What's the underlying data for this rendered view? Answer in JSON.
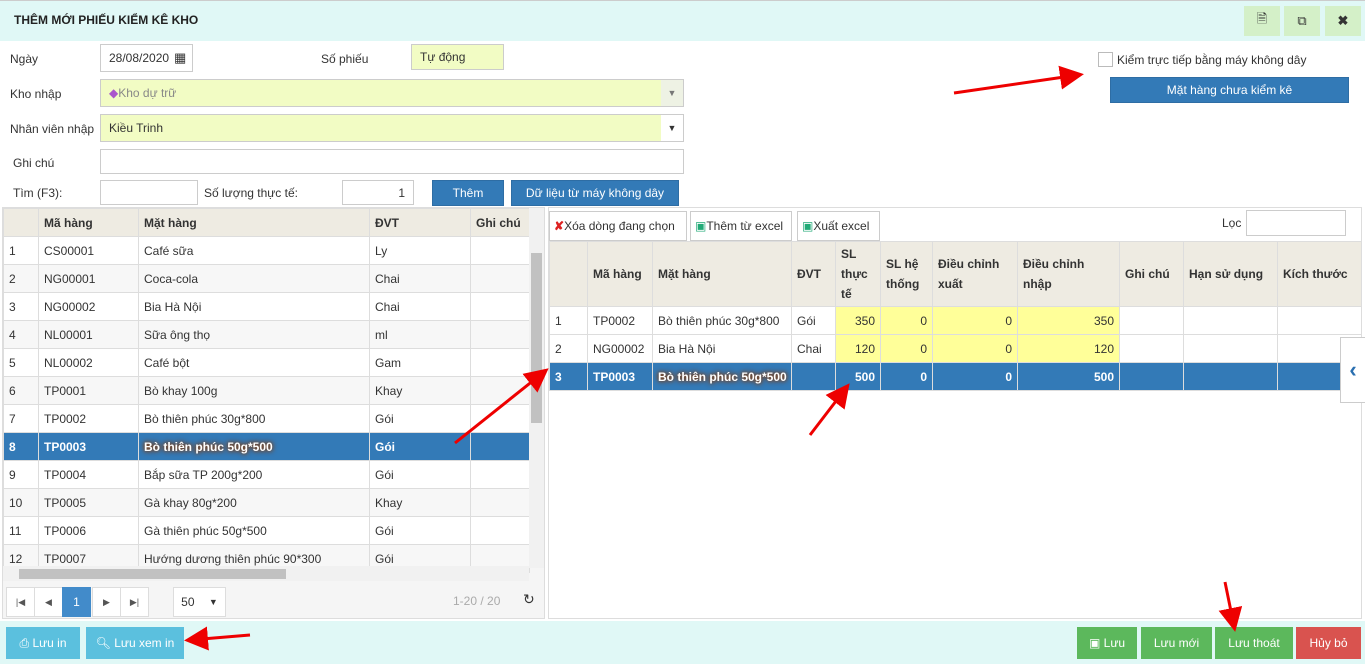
{
  "window": {
    "title": "THÊM MỚI PHIẾU KIỂM KÊ KHO",
    "icons": [
      "document-icon",
      "copy-icon",
      "close-icon"
    ]
  },
  "form": {
    "date_label": "Ngày",
    "date_value": "28/08/2020",
    "voucher_label": "Số phiếu",
    "voucher_value": "Tự động",
    "warehouse_label": "Kho nhập",
    "warehouse_value": "Kho dự trữ",
    "staff_label": "Nhân viên nhập",
    "staff_value": "Kiều Trinh",
    "note_label": "Ghi chú",
    "note_value": "",
    "search_label": "Tìm (F3):",
    "search_value": "",
    "qty_label": "Số lượng thực tế:",
    "qty_value": "1",
    "add_button": "Thêm",
    "wireless_button": "Dữ liệu từ máy không dây",
    "direct_check_label": "Kiểm trực tiếp bằng máy không dây",
    "direct_check_checked": false,
    "unchecked_items_button": "Mặt hàng chưa kiểm kê"
  },
  "left_table": {
    "columns": [
      "",
      "Mã hàng",
      "Mặt hàng",
      "ĐVT",
      "Ghi chú"
    ],
    "rows": [
      [
        "1",
        "CS00001",
        "Café sữa",
        "Ly",
        ""
      ],
      [
        "2",
        "NG00001",
        "Coca-cola",
        "Chai",
        ""
      ],
      [
        "3",
        "NG00002",
        "Bia Hà Nội",
        "Chai",
        ""
      ],
      [
        "4",
        "NL00001",
        "Sữa ông thọ",
        "ml",
        ""
      ],
      [
        "5",
        "NL00002",
        "Café bột",
        "Gam",
        ""
      ],
      [
        "6",
        "TP0001",
        "Bò khay 100g",
        "Khay",
        ""
      ],
      [
        "7",
        "TP0002",
        "Bò thiên phúc 30g*800",
        "Gói",
        ""
      ],
      [
        "8",
        "TP0003",
        "Bò thiên phúc 50g*500",
        "Gói",
        ""
      ],
      [
        "9",
        "TP0004",
        "Bắp sữa TP 200g*200",
        "Gói",
        ""
      ],
      [
        "10",
        "TP0005",
        "Gà khay 80g*200",
        "Khay",
        ""
      ],
      [
        "11",
        "TP0006",
        "Gà thiên phúc 50g*500",
        "Gói",
        ""
      ],
      [
        "12",
        "TP0007",
        "Hướng dương thiên phúc 90*300",
        "Gói",
        ""
      ]
    ],
    "selected_row": 8,
    "pager": {
      "page": "1",
      "page_size": "50",
      "range": "1-20 / 20"
    }
  },
  "right_toolbar": {
    "delete": "Xóa dòng đang chọn",
    "import": "Thêm từ excel",
    "export": "Xuất excel",
    "filter_label": "Lọc",
    "filter_value": ""
  },
  "right_table": {
    "columns": [
      "",
      "Mã hàng",
      "Mặt hàng",
      "ĐVT",
      "SL thực tế",
      "SL hệ thống",
      "Điều chỉnh xuất",
      "Điều chỉnh nhập",
      "Ghi chú",
      "Hạn sử dụng",
      "Kích thước"
    ],
    "rows": [
      [
        "1",
        "TP0002",
        "Bò thiên phúc 30g*800",
        "Gói",
        "350",
        "0",
        "0",
        "350",
        "",
        "",
        ""
      ],
      [
        "2",
        "NG00002",
        "Bia Hà Nội",
        "Chai",
        "120",
        "0",
        "0",
        "120",
        "",
        "",
        ""
      ],
      [
        "3",
        "TP0003",
        "Bò thiên phúc 50g*500",
        "",
        "500",
        "0",
        "0",
        "500",
        "",
        "",
        ""
      ]
    ],
    "selected_row": 3
  },
  "footer": {
    "save_print": "Lưu in",
    "save_preview": "Lưu xem in",
    "save": "Lưu",
    "save_new": "Lưu mới",
    "save_exit": "Lưu thoát",
    "cancel": "Hủy bỏ"
  },
  "colors": {
    "header_bg": "#e0f8f6",
    "primary": "#337ab7",
    "success": "#5cb85c",
    "danger": "#d9534f",
    "info": "#5bc0de",
    "highlight": "#ffff99"
  }
}
